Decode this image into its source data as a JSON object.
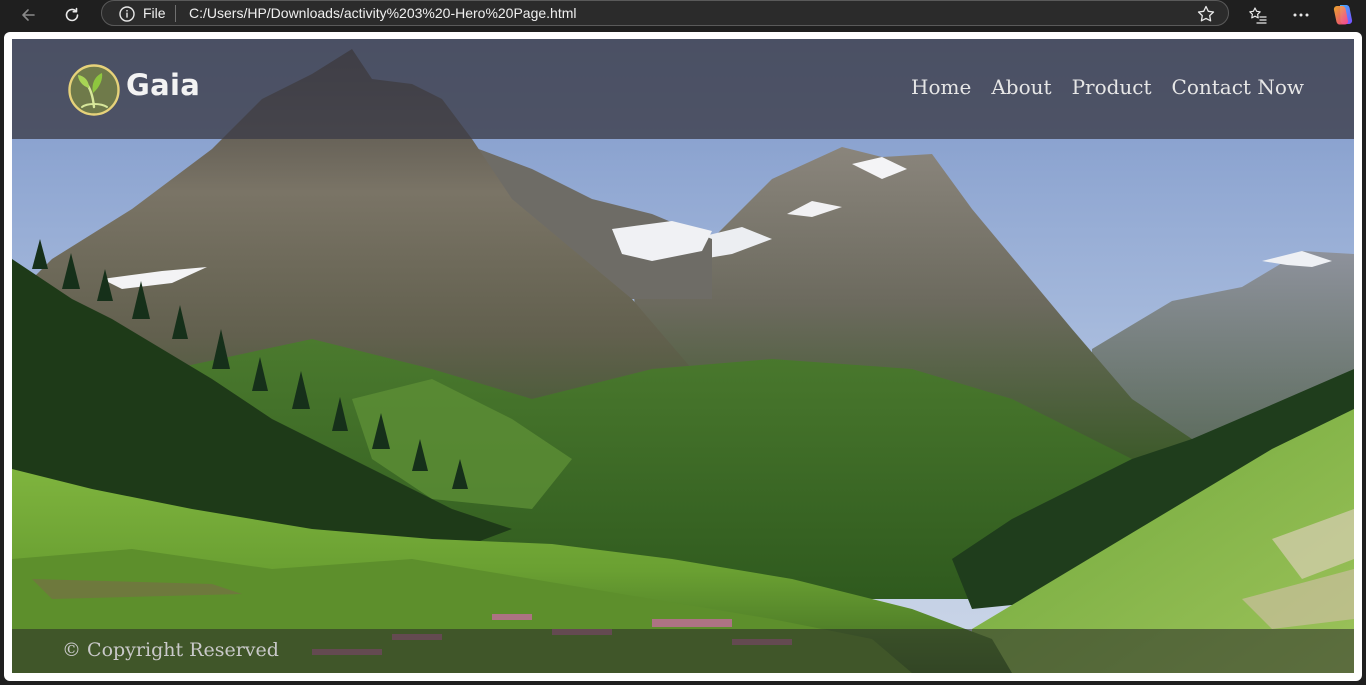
{
  "browser": {
    "file_label": "File",
    "url": "C:/Users/HP/Downloads/activity%203%20-Hero%20Page.html",
    "icons": {
      "back": "arrow-left-icon",
      "reload": "reload-icon",
      "info": "info-icon",
      "favorite": "star-icon",
      "favorites": "favorites-list-icon",
      "more": "more-icon",
      "copilot": "copilot-icon"
    }
  },
  "site": {
    "brand": "Gaia",
    "logo_icon": "leaf-logo-icon",
    "nav": [
      {
        "label": "Home"
      },
      {
        "label": "About"
      },
      {
        "label": "Product"
      },
      {
        "label": "Contact Now"
      }
    ],
    "footer_text": "© Copyright Reserved",
    "hero_image": "mountain-valley-landscape",
    "colors": {
      "header_overlay": "#3c3c48",
      "logo_ring": "#e6d27a",
      "footer_overlay": "#282828"
    }
  }
}
